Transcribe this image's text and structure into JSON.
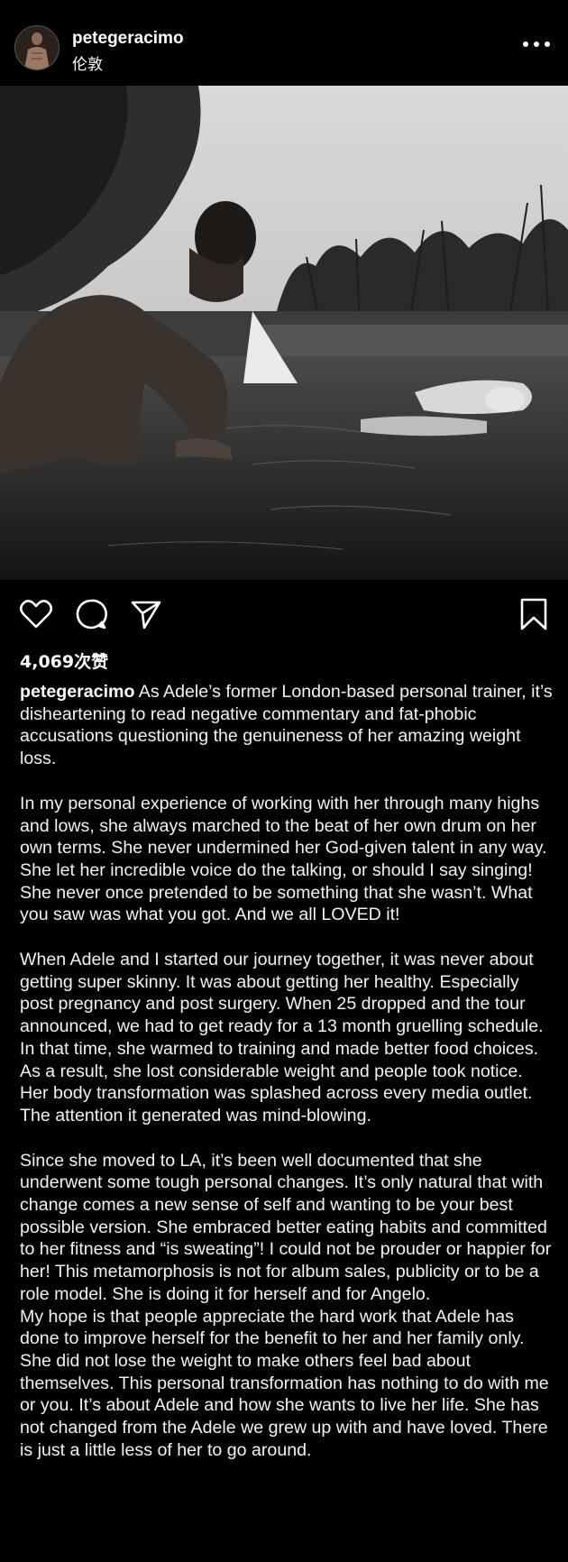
{
  "header": {
    "username": "petegeracimo",
    "location": "伦敦",
    "more_icon": "more-horizontal-icon"
  },
  "post": {
    "photo_description_icon": "post-photo",
    "likes": "4,069次赞",
    "actions": {
      "like_icon": "heart-icon",
      "comment_icon": "comment-icon",
      "share_icon": "send-icon",
      "save_icon": "bookmark-icon"
    }
  },
  "caption": {
    "username": "petegeracimo",
    "p1": "As Adele’s former London-based personal trainer, it’s disheartening to read negative commentary and fat-phobic accusations questioning the genuineness of her amazing weight loss.",
    "p2": "In my personal experience of working with her through many highs and lows, she always marched to the beat of her own drum on her own terms. She never undermined her God-given talent in any way. She let her incredible voice do the talking, or should I say singing! She never once pretended to be something that she wasn’t. What you saw was what you got. And we all LOVED it!",
    "p3": "When Adele and I started our journey together, it was never about getting super skinny. It was about getting her healthy. Especially post pregnancy and post surgery. When 25 dropped and the tour announced, we had to get ready for a 13 month gruelling schedule. In that time, she warmed to training and made better food choices. As a result, she lost considerable weight and people took notice. Her body transformation was splashed across every media outlet. The attention it generated was mind-blowing.",
    "p4": "Since she moved to LA, it’s been well documented that she underwent some tough personal changes. It’s only natural that with change comes a new sense of self and wanting to be your best possible version. She embraced better eating habits and committed to her fitness and “is sweating”! I could not be prouder or happier for her! This metamorphosis is not for album sales, publicity or to be a role model.  She is doing it for herself and for Angelo.",
    "p5": "My hope is that people appreciate the hard work that Adele has done to improve herself for the benefit to her and her family only. She did not lose the weight to make others feel bad about themselves. This personal transformation has nothing to do with me or you. It’s about Adele and how she wants to live her life. She has not changed from the Adele we grew up with and have loved. There is just a little less of her to go around."
  },
  "colors": {
    "background": "#000000",
    "text": "#ffffff"
  }
}
